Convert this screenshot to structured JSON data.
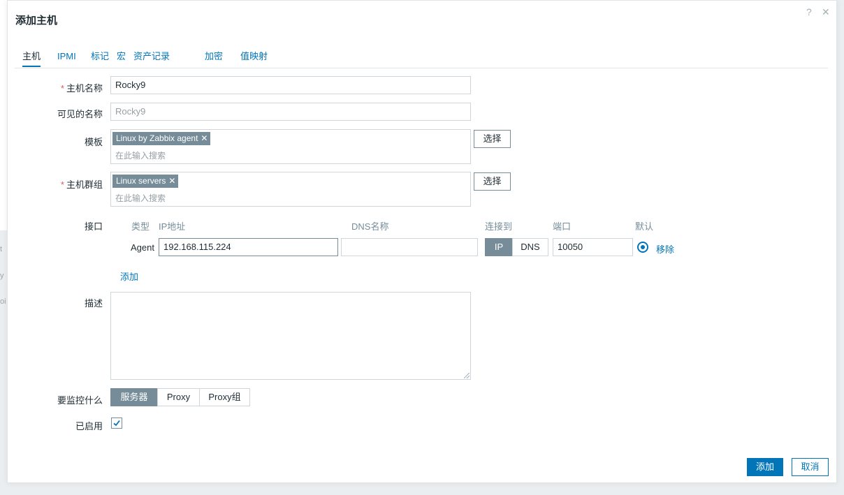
{
  "dialog": {
    "title": "添加主机",
    "help_icon": "question-icon",
    "close_icon": "close-icon"
  },
  "tabs": [
    {
      "label": "主机",
      "active": true
    },
    {
      "label": "IPMI"
    },
    {
      "label": "标记"
    },
    {
      "label": "宏"
    },
    {
      "label": "资产记录"
    },
    {
      "label": "加密"
    },
    {
      "label": "值映射"
    }
  ],
  "form": {
    "host_name": {
      "label": "主机名称",
      "value": "Rocky9"
    },
    "visible_name": {
      "label": "可见的名称",
      "placeholder": "Rocky9"
    },
    "templates": {
      "label": "模板",
      "chip": "Linux by Zabbix agent",
      "placeholder": "在此输入搜索",
      "select": "选择"
    },
    "host_groups": {
      "label": "主机群组",
      "chip": "Linux servers",
      "placeholder": "在此输入搜索",
      "select": "选择"
    },
    "interfaces": {
      "label": "接口",
      "columns": {
        "type": "类型",
        "ip": "IP地址",
        "dns": "DNS名称",
        "connect": "连接到",
        "port": "端口",
        "default": "默认"
      },
      "row": {
        "type": "Agent",
        "ip": "192.168.115.224",
        "dns": "",
        "connect_ip": "IP",
        "connect_dns": "DNS",
        "port": "10050",
        "remove": "移除"
      },
      "add": "添加"
    },
    "description": {
      "label": "描述",
      "value": ""
    },
    "monitored_by": {
      "label": "要监控什么",
      "options": [
        "服务器",
        "Proxy",
        "Proxy组"
      ],
      "selected": "服务器"
    },
    "enabled": {
      "label": "已启用",
      "checked": true
    }
  },
  "footer": {
    "add": "添加",
    "cancel": "取消"
  },
  "background": {
    "glyphs": [
      "t",
      "y",
      "oi"
    ]
  }
}
